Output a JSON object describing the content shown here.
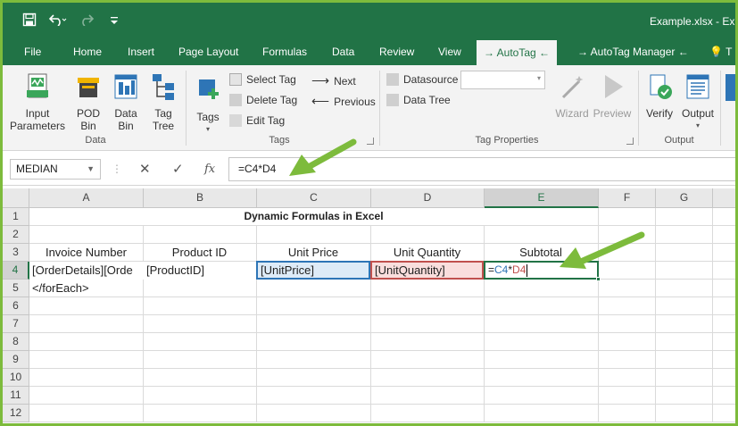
{
  "titlebar": {
    "filename": "Example.xlsx  -  Ex"
  },
  "qat": {
    "save_icon": "save-icon",
    "undo_icon": "undo-icon",
    "redo_icon": "redo-icon",
    "customize_icon": "customize-icon"
  },
  "tabs": [
    "File",
    "Home",
    "Insert",
    "Page Layout",
    "Formulas",
    "Data",
    "Review",
    "View",
    "→ AutoTag ←",
    "→ AutoTag Manager ←",
    "T"
  ],
  "ribbon": {
    "data_group": {
      "label": "Data",
      "input_parameters": "Input Parameters",
      "pod_bin": "POD Bin",
      "data_bin": "Data Bin",
      "tag_tree": "Tag Tree"
    },
    "tags_group": {
      "label": "Tags",
      "tags": "Tags",
      "select_tag": "Select Tag",
      "delete_tag": "Delete Tag",
      "edit_tag": "Edit Tag",
      "next": "Next",
      "previous": "Previous"
    },
    "tagprops_group": {
      "label": "Tag Properties",
      "datasource": "Datasource",
      "data_tree": "Data Tree",
      "wizard": "Wizard",
      "preview": "Preview"
    },
    "output_group": {
      "label": "Output",
      "verify": "Verify",
      "output": "Output"
    }
  },
  "formula_bar": {
    "name_box": "MEDIAN",
    "formula": "=C4*D4"
  },
  "columns": [
    "A",
    "B",
    "C",
    "D",
    "E",
    "F",
    "G"
  ],
  "rows": [
    "1",
    "2",
    "3",
    "4",
    "5",
    "6",
    "7",
    "8",
    "9",
    "10",
    "11",
    "12"
  ],
  "sheet": {
    "title": "Dynamic Formulas in Excel",
    "headers": {
      "a": "Invoice Number",
      "b": "Product ID",
      "c": "Unit Price",
      "d": "Unit Quantity",
      "e": "Subtotal"
    },
    "row4": {
      "a": "[OrderDetails][Orde",
      "b": "[ProductID]",
      "c": "[UnitPrice]",
      "d": "[UnitQuantity]"
    },
    "e4": {
      "eq": "=",
      "ref1": "C4",
      "op": "*",
      "ref2": "D4"
    },
    "row5": {
      "a": "</forEach>"
    }
  },
  "colors": {
    "excel_green": "#217346",
    "arrow_green": "#7dbb3c",
    "ref_blue": "#2e75b6",
    "ref_red": "#c0504d"
  }
}
